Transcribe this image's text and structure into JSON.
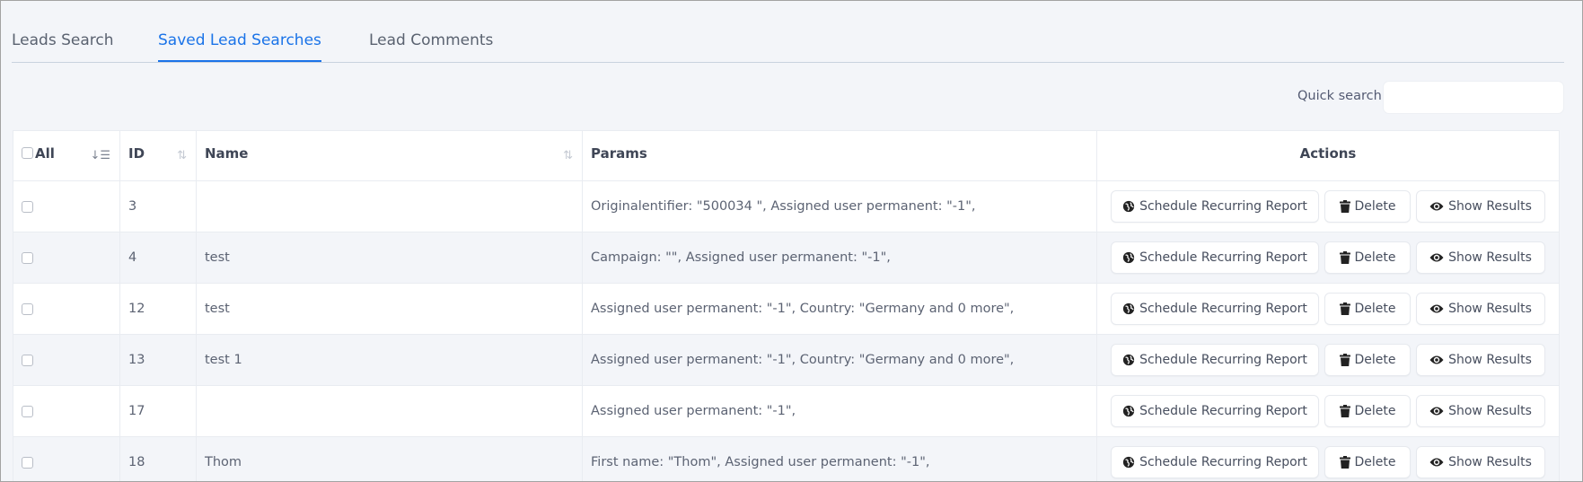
{
  "tabs": [
    {
      "label": "Leads Search",
      "active": false
    },
    {
      "label": "Saved Lead Searches",
      "active": true
    },
    {
      "label": "Lead Comments",
      "active": false
    }
  ],
  "quick_search": {
    "label": "Quick search:",
    "value": "",
    "placeholder": ""
  },
  "table": {
    "headers": {
      "select_all": "All",
      "id": "ID",
      "name": "Name",
      "params": "Params",
      "actions": "Actions"
    },
    "action_labels": {
      "schedule": "Schedule Recurring Report",
      "delete": "Delete",
      "show": "Show Results"
    },
    "rows": [
      {
        "id": "3",
        "name": "",
        "params": "Originalentifier: \"500034 \", Assigned user permanent: \"-1\","
      },
      {
        "id": "4",
        "name": "test",
        "params": "Campaign: \"\", Assigned user permanent: \"-1\","
      },
      {
        "id": "12",
        "name": "test",
        "params": "Assigned user permanent: \"-1\", Country: \"Germany and 0 more\","
      },
      {
        "id": "13",
        "name": "test 1",
        "params": "Assigned user permanent: \"-1\", Country: \"Germany and 0 more\","
      },
      {
        "id": "17",
        "name": "",
        "params": "Assigned user permanent: \"-1\","
      },
      {
        "id": "18",
        "name": "Thom",
        "params": "First name: \"Thom\", Assigned user permanent: \"-1\","
      }
    ]
  },
  "colors": {
    "accent": "#1a73e8",
    "background": "#f3f5f9",
    "row_alt": "#f3f5f9",
    "text": "#5c6373"
  }
}
